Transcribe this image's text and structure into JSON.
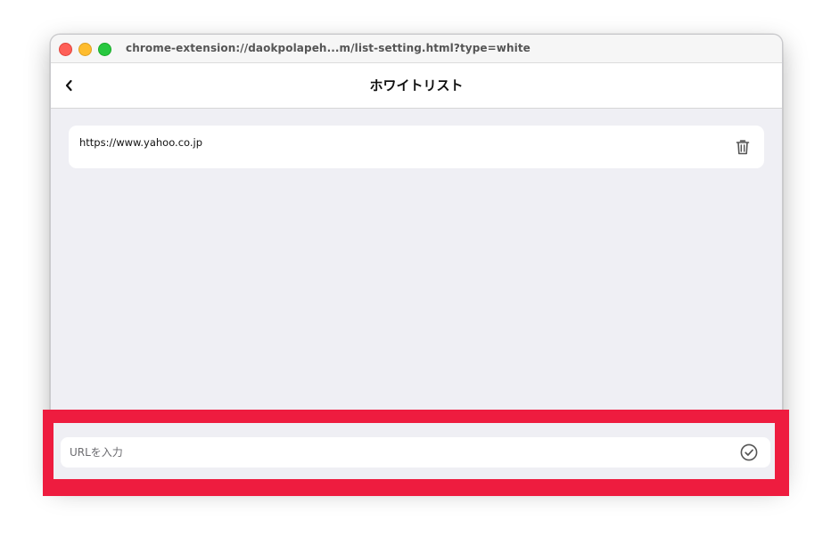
{
  "window": {
    "title_url": "chrome-extension://daokpolapeh...m/list-setting.html?type=white"
  },
  "header": {
    "back_icon": "chevron-left-icon",
    "title": "ホワイトリスト"
  },
  "list": {
    "items": [
      {
        "url": "https://www.yahoo.co.jp",
        "action_icon": "trash-icon"
      }
    ]
  },
  "input": {
    "placeholder": "URLを入力",
    "value": "",
    "confirm_icon": "check-circle-icon"
  },
  "colors": {
    "highlight": "#ee1c3f",
    "background": "#efeff4"
  }
}
